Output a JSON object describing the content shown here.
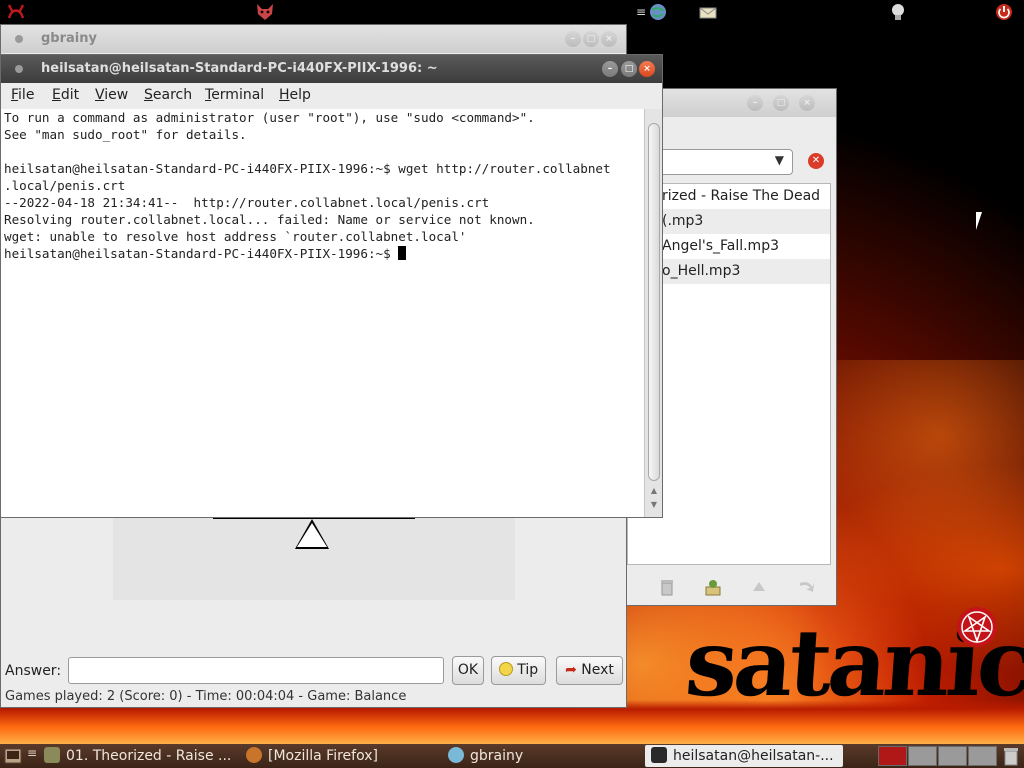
{
  "gbrainy_window": {
    "title": "gbrainy",
    "answer_label": "Answer:",
    "answer_value": "",
    "ok_label": "OK",
    "tip_label": "Tip",
    "next_label": "Next",
    "status": "Games played: 2 (Score: 0) - Time: 00:04:04 - Game: Balance"
  },
  "player_window": {
    "playlist": [
      "rized - Raise The Dead",
      "(.mp3",
      "Angel's_Fall.mp3",
      "o_Hell.mp3"
    ],
    "dropdown_arrow": "▼",
    "clear_symbol": "✕"
  },
  "terminal": {
    "title": "heilsatan@heilsatan-Standard-PC-i440FX-PIIX-1996: ~",
    "menu": [
      "File",
      "Edit",
      "View",
      "Search",
      "Terminal",
      "Help"
    ],
    "lines": [
      "To run a command as administrator (user \"root\"), use \"sudo <command>\".",
      "See \"man sudo_root\" for details.",
      "",
      "heilsatan@heilsatan-Standard-PC-i440FX-PIIX-1996:~$ wget http://router.collabnet",
      ".local/penis.crt",
      "--2022-04-18 21:34:41--  http://router.collabnet.local/penis.crt",
      "Resolving router.collabnet.local... failed: Name or service not known.",
      "wget: unable to resolve host address `router.collabnet.local'"
    ],
    "prompt": "heilsatan@heilsatan-Standard-PC-i440FX-PIIX-1996:~$ "
  },
  "wallpaper": {
    "logo_text": "satanic"
  },
  "taskbar": {
    "tasks": [
      {
        "label": "01. Theorized - Raise ...",
        "icon": "music-player-icon"
      },
      {
        "label": "[Mozilla Firefox]",
        "icon": "firefox-icon"
      },
      {
        "label": "gbrainy",
        "icon": "gbrainy-icon"
      },
      {
        "label": "heilsatan@heilsatan-...",
        "icon": "terminal-icon"
      }
    ]
  },
  "colors": {
    "title_active": "#3c3c3c",
    "close_button": "#e0531f",
    "workspace_current": "#b01818"
  }
}
